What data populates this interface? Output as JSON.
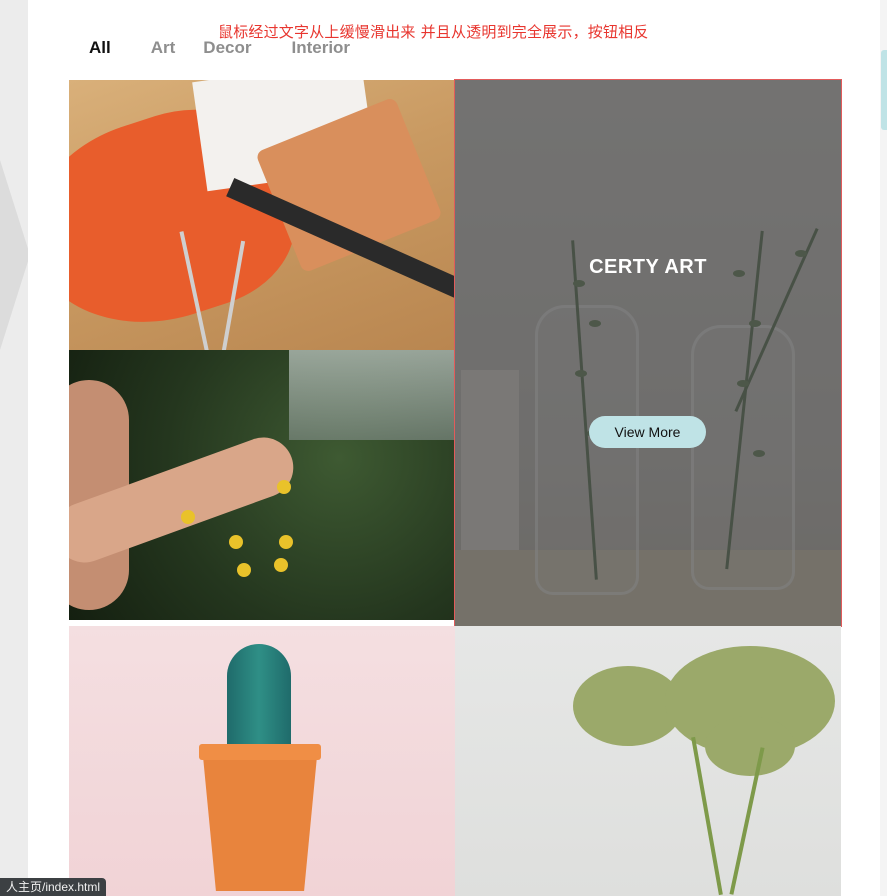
{
  "annotation_note": "鼠标经过文字从上缓慢滑出来 并且从透明到完全展示，按钮相反",
  "filters": [
    {
      "label": "All",
      "active": true
    },
    {
      "label": "Art",
      "active": false
    },
    {
      "label": "Decor",
      "active": false
    },
    {
      "label": "Interior",
      "active": false
    }
  ],
  "portfolio": {
    "hovered_title": "CERTY ART",
    "view_more_label": "View More"
  },
  "status_bar": {
    "url_text": "人主页/index.html"
  },
  "colors": {
    "accent_button": "#bfe3e6",
    "annotation_red": "#e8362f",
    "active_filter": "#111111",
    "inactive_filter": "#8e8e8e"
  }
}
